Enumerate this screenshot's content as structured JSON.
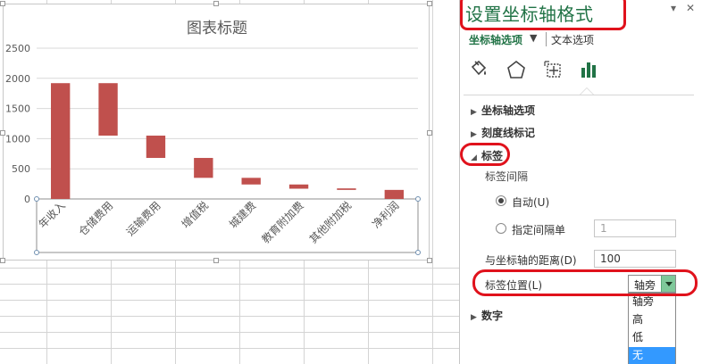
{
  "chart": {
    "title": "图表标题"
  },
  "chart_data": {
    "type": "bar",
    "categories": [
      "年收入",
      "仓储费用",
      "运输费用",
      "增值税",
      "城建费",
      "教育附加费",
      "其他附加税",
      "净利润"
    ],
    "ranges": [
      [
        0,
        1920
      ],
      [
        1050,
        1920
      ],
      [
        680,
        1050
      ],
      [
        350,
        680
      ],
      [
        240,
        350
      ],
      [
        170,
        240
      ],
      [
        150,
        175
      ],
      [
        0,
        150
      ]
    ],
    "y_ticks": [
      "0",
      "500",
      "1000",
      "1500",
      "2000",
      "2500"
    ],
    "ylim": [
      0,
      2500
    ],
    "grid": true,
    "colors": {
      "bar": "#c0504d"
    }
  },
  "pane": {
    "title": "设置坐标轴格式",
    "dropdown_icon": "▼",
    "pin_icon": "▾",
    "close_icon": "✕",
    "tab_axis": "坐标轴选项",
    "tab_axis_arrow": "▼",
    "tab_text": "文本选项",
    "icons": [
      "fill-icon",
      "pentagon-icon",
      "size-properties-icon",
      "bar-chart-icon"
    ],
    "sections": {
      "axis_options": "坐标轴选项",
      "tick_marks": "刻度线标记",
      "labels": "标签",
      "number": "数字"
    },
    "label_interval": "标签间隔",
    "auto": "自动(U)",
    "specify_interval": "指定间隔单",
    "interval_value": "1",
    "distance_label": "与坐标轴的距离(D)",
    "distance_value": "100",
    "label_position": "标签位置(L)",
    "label_position_value": "轴旁",
    "options": [
      "轴旁",
      "高",
      "低",
      "无"
    ]
  },
  "colors": {
    "accent": "#217346",
    "highlight": "#e0121c",
    "selection": "#3399ff"
  }
}
